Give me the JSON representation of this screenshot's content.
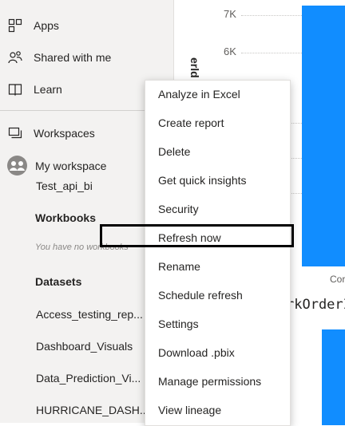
{
  "nav": {
    "apps": "Apps",
    "shared": "Shared with me",
    "learn": "Learn",
    "workspaces": "Workspaces",
    "my_workspace": "My workspace",
    "workspace_name": "Test_api_bi",
    "workbooks_heading": "Workbooks",
    "workbooks_empty": "You have no workbooks",
    "datasets_heading": "Datasets",
    "datasets": [
      "Access_testing_rep...",
      "Dashboard_Visuals",
      "Data_Prediction_Vi...",
      "HURRICANE_DASH..."
    ]
  },
  "chart": {
    "ticks": [
      "7K",
      "6K"
    ],
    "axis_title": "erld",
    "category_label": "Cor",
    "second_title": "rkOrderI"
  },
  "menu": {
    "items": [
      "Analyze in Excel",
      "Create report",
      "Delete",
      "Get quick insights",
      "Security",
      "Refresh now",
      "Rename",
      "Schedule refresh",
      "Settings",
      "Download .pbix",
      "Manage permissions",
      "View lineage"
    ],
    "highlighted": "Refresh now"
  },
  "colors": {
    "bar": "#118dff",
    "nav_bg": "#f3f2f1",
    "highlight_border": "#000000"
  }
}
